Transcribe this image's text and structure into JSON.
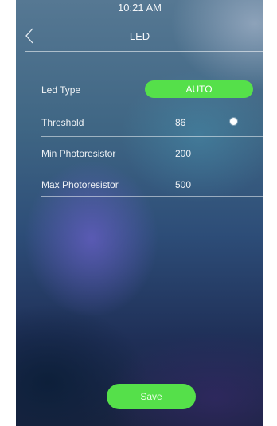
{
  "status_bar": {
    "time": "10:21 AM"
  },
  "header": {
    "title": "LED",
    "back_icon": "chevron-left-icon"
  },
  "settings": {
    "led_type": {
      "label": "Led Type",
      "value": "AUTO"
    },
    "threshold": {
      "label": "Threshold",
      "value": "86"
    },
    "min_photoresistor": {
      "label": "Min Photoresistor",
      "value": "200"
    },
    "max_photoresistor": {
      "label": "Max Photoresistor",
      "value": "500"
    }
  },
  "actions": {
    "save_label": "Save"
  },
  "colors": {
    "accent": "#55e04a"
  }
}
